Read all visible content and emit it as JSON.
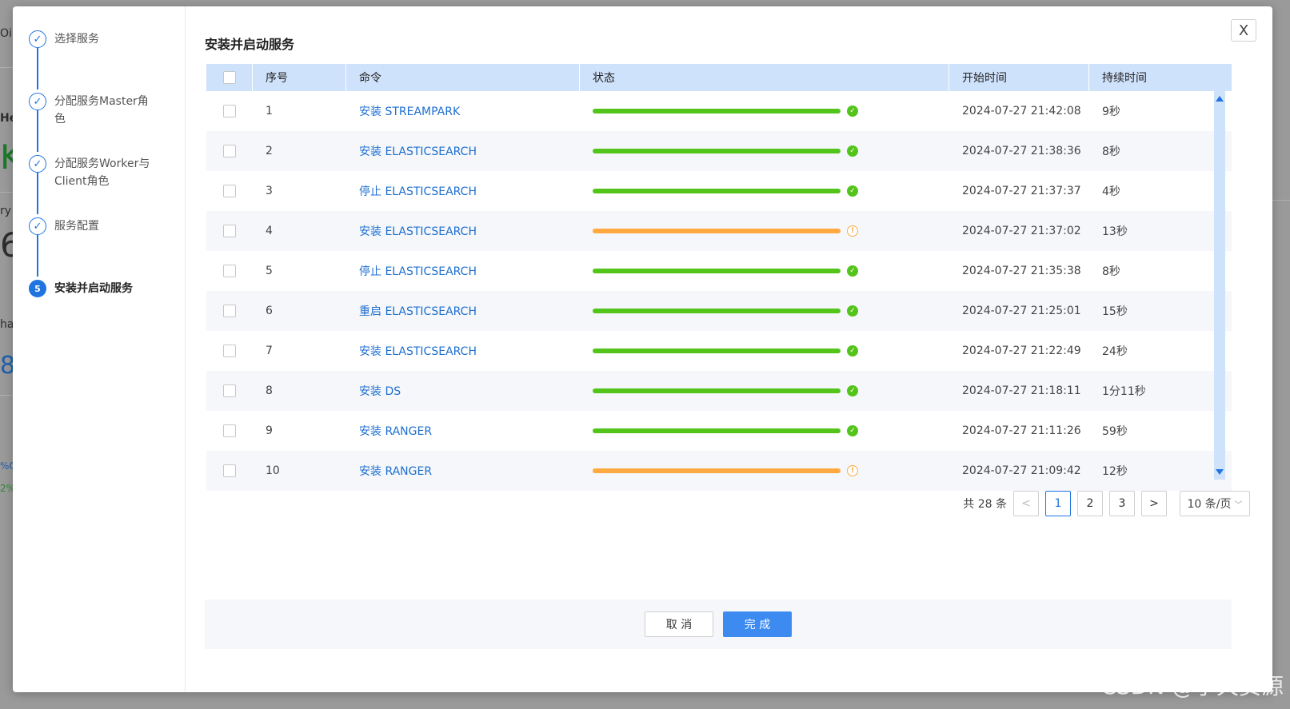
{
  "background": {
    "fragments": [
      "Oi",
      "Hea",
      "K",
      "ry",
      "6",
      "har",
      "8",
      "%C",
      "2%"
    ]
  },
  "steps": [
    {
      "label": "选择服务",
      "state": "done"
    },
    {
      "label": "分配服务Master角色",
      "state": "done"
    },
    {
      "label": "分配服务Worker与Client角色",
      "state": "done"
    },
    {
      "label": "服务配置",
      "state": "done"
    },
    {
      "label": "安装并启动服务",
      "state": "active",
      "number": "5"
    }
  ],
  "dialog": {
    "title": "安装并启动服务",
    "close_label": "X"
  },
  "table": {
    "columns": [
      "序号",
      "命令",
      "状态",
      "开始时间",
      "持续时间"
    ],
    "rows": [
      {
        "idx": "1",
        "cmd": "安装 STREAMPARK",
        "status": "ok",
        "start": "2024-07-27 21:42:08",
        "dur": "9秒"
      },
      {
        "idx": "2",
        "cmd": "安装 ELASTICSEARCH",
        "status": "ok",
        "start": "2024-07-27 21:38:36",
        "dur": "8秒"
      },
      {
        "idx": "3",
        "cmd": "停止 ELASTICSEARCH",
        "status": "ok",
        "start": "2024-07-27 21:37:37",
        "dur": "4秒"
      },
      {
        "idx": "4",
        "cmd": "安装 ELASTICSEARCH",
        "status": "warn",
        "start": "2024-07-27 21:37:02",
        "dur": "13秒"
      },
      {
        "idx": "5",
        "cmd": "停止 ELASTICSEARCH",
        "status": "ok",
        "start": "2024-07-27 21:35:38",
        "dur": "8秒"
      },
      {
        "idx": "6",
        "cmd": "重启 ELASTICSEARCH",
        "status": "ok",
        "start": "2024-07-27 21:25:01",
        "dur": "15秒"
      },
      {
        "idx": "7",
        "cmd": "安装 ELASTICSEARCH",
        "status": "ok",
        "start": "2024-07-27 21:22:49",
        "dur": "24秒"
      },
      {
        "idx": "8",
        "cmd": "安装 DS",
        "status": "ok",
        "start": "2024-07-27 21:18:11",
        "dur": "1分11秒"
      },
      {
        "idx": "9",
        "cmd": "安装 RANGER",
        "status": "ok",
        "start": "2024-07-27 21:11:26",
        "dur": "59秒"
      },
      {
        "idx": "10",
        "cmd": "安装 RANGER",
        "status": "warn",
        "start": "2024-07-27 21:09:42",
        "dur": "12秒"
      }
    ],
    "status_colors": {
      "ok": "#52c41a",
      "warn": "#ffa940"
    }
  },
  "pagination": {
    "total_text": "共 28 条",
    "prev": "<",
    "next": ">",
    "pages": [
      "1",
      "2",
      "3"
    ],
    "current": "1",
    "page_size": "10 条/页"
  },
  "footer": {
    "cancel_label": "取 消",
    "ok_label": "完 成"
  },
  "watermark": "CSDN @小天资源",
  "colors": {
    "accent": "#1f74e0",
    "header_bg": "#cfe2fb",
    "link": "#1f6fd0"
  }
}
